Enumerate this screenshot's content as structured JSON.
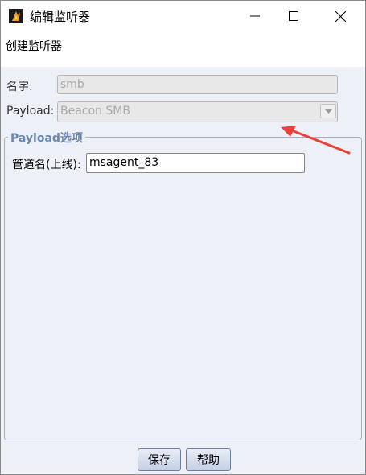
{
  "window": {
    "title": "编辑监听器",
    "minimize_icon": "minimize-icon",
    "maximize_icon": "maximize-icon",
    "close_icon": "close-icon"
  },
  "banner": {
    "text": "创建监听器"
  },
  "form": {
    "name_label": "名字:",
    "name_value": "smb",
    "payload_label": "Payload:",
    "payload_value": "Beacon SMB",
    "payload_dropdown_icon": "chevron-down-icon"
  },
  "payload_options": {
    "title": "Payload选项",
    "pipe_label": "管道名(上线):",
    "pipe_value": "msagent_83"
  },
  "buttons": {
    "save": "保存",
    "help": "帮助"
  },
  "colors": {
    "annotation_arrow": "#e8423a",
    "group_title": "#6a87ad",
    "background": "#eef0f8"
  }
}
